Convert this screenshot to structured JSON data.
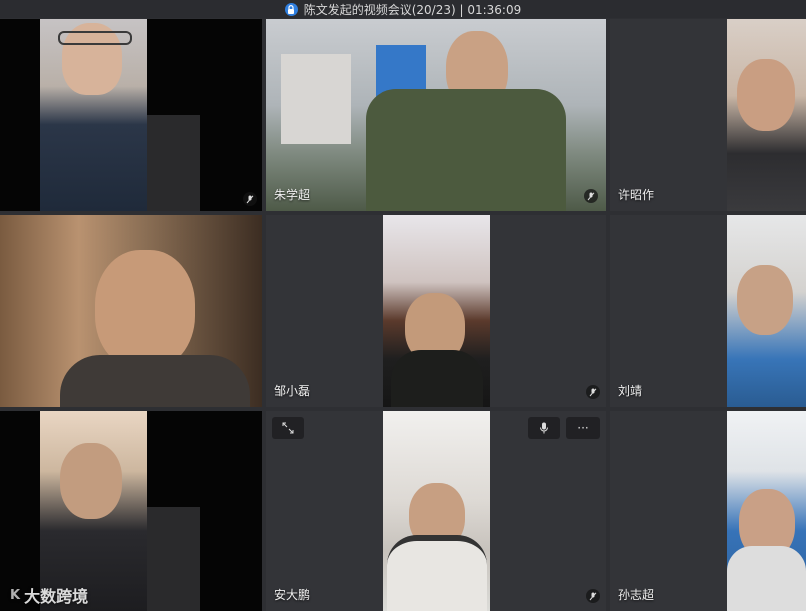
{
  "window": {
    "title": "陈文发起的视频会议(20/23) | 01:36:09"
  },
  "participants": [
    {
      "name": "",
      "mic": "mic-muted-icon"
    },
    {
      "name": "朱学超",
      "mic": "mic-muted-icon"
    },
    {
      "name": "许昭作",
      "mic": ""
    },
    {
      "name": "",
      "mic": ""
    },
    {
      "name": "邹小磊",
      "mic": ""
    },
    {
      "name": "",
      "mic": "mic-muted-icon"
    },
    {
      "name": "刘靖",
      "mic": ""
    },
    {
      "name": "",
      "mic": ""
    },
    {
      "name": "安大鹏",
      "mic": ""
    },
    {
      "name": "",
      "mic": "mic-muted-icon"
    },
    {
      "name": "孙志超",
      "mic": ""
    }
  ],
  "watermark": {
    "text": "大数跨境"
  },
  "colors": {
    "background": "#2e2f33",
    "lock_icon": "#2f7fe0"
  }
}
